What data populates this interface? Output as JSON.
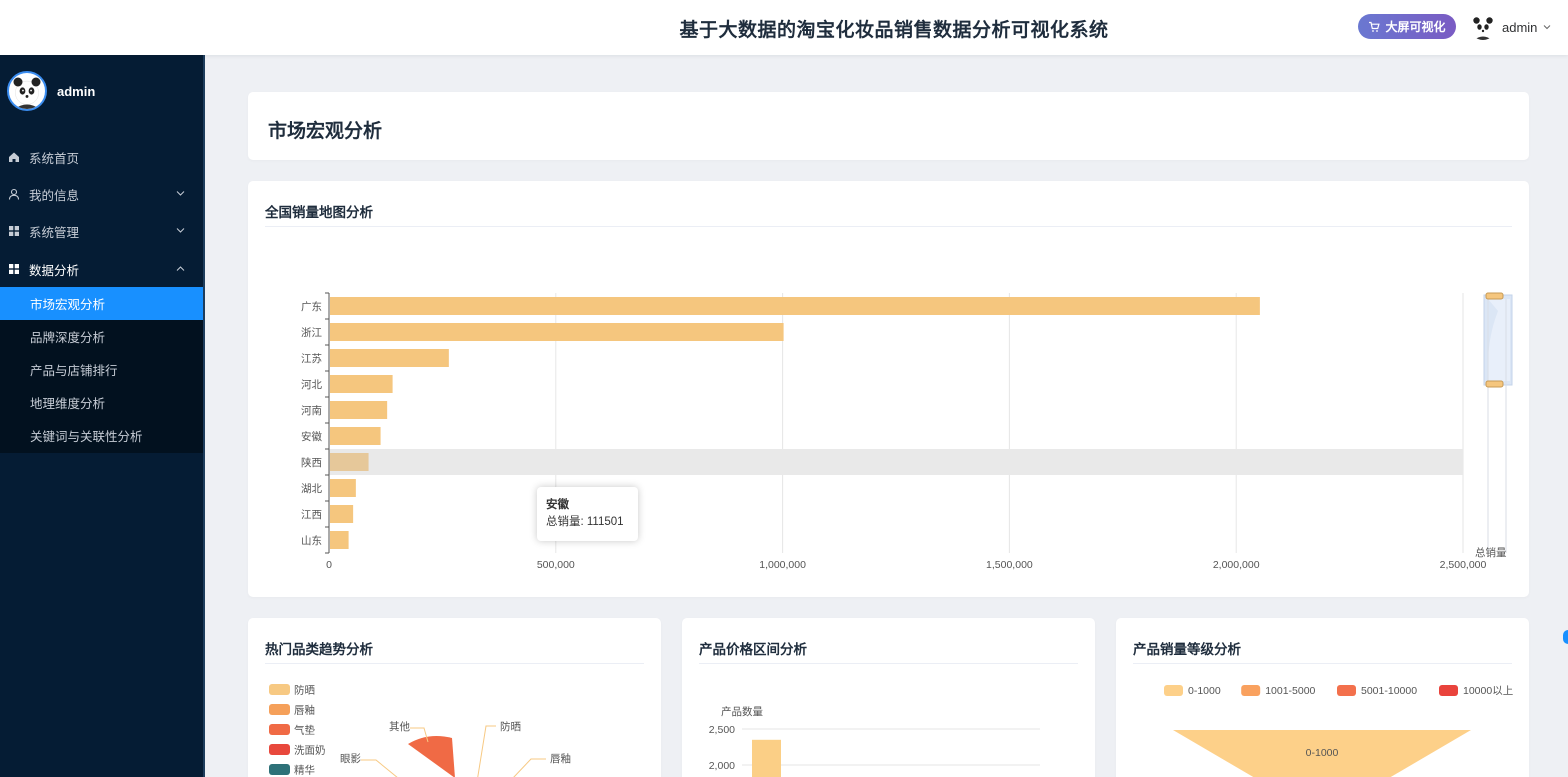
{
  "header": {
    "title": "基于大数据的淘宝化妆品销售数据分析可视化系统",
    "bigscreen_label": "大屏可视化",
    "username": "admin"
  },
  "sidebar": {
    "username": "admin",
    "menu": [
      {
        "label": "系统首页",
        "icon": "home-icon"
      },
      {
        "label": "我的信息",
        "icon": "user-icon"
      },
      {
        "label": "系统管理",
        "icon": "grid-icon"
      },
      {
        "label": "数据分析",
        "icon": "grid-icon"
      }
    ],
    "submenu": [
      {
        "label": "市场宏观分析",
        "active": true
      },
      {
        "label": "品牌深度分析"
      },
      {
        "label": "产品与店铺排行"
      },
      {
        "label": "地理维度分析"
      },
      {
        "label": "关键词与关联性分析"
      }
    ]
  },
  "page": {
    "title": "市场宏观分析"
  },
  "map_card": {
    "title": "全国销量地图分析",
    "tooltip": {
      "name": "安徽",
      "label": "总销量: 111501"
    }
  },
  "bottom_cards": [
    {
      "title": "热门品类趋势分析"
    },
    {
      "title": "产品价格区间分析"
    },
    {
      "title": "产品销量等级分析"
    }
  ],
  "chart_data": [
    {
      "type": "bar",
      "orientation": "horizontal",
      "categories": [
        "广东",
        "浙江",
        "江苏",
        "河北",
        "河南",
        "安徽",
        "陕西",
        "湖北",
        "江西",
        "山东"
      ],
      "values": [
        2050000,
        1000000,
        262000,
        138000,
        126000,
        111501,
        85000,
        57000,
        51000,
        41000
      ],
      "xlim": [
        0,
        2500000
      ],
      "xticks": [
        "0",
        "500,000",
        "1,000,000",
        "1,500,000",
        "2,000,000",
        "2,500,000"
      ],
      "color": "#f5c67e",
      "highlight_category": "陕西",
      "visual_map_label": "总销量",
      "grid": true
    },
    {
      "type": "pie",
      "legend": [
        "防晒",
        "唇釉",
        "气垫",
        "洗面奶",
        "精华"
      ],
      "slice_labels": [
        "其他",
        "防晒",
        "眼影",
        "唇釉"
      ],
      "colors": [
        "#f7c983",
        "#f5a05a",
        "#f06a45",
        "#e8483c",
        "#2e7178"
      ]
    },
    {
      "type": "bar",
      "ylabel": "产品数量",
      "yticks": [
        "2,500",
        "2,000"
      ],
      "color": "#fbcf86",
      "values": [
        2350
      ]
    },
    {
      "type": "funnel",
      "legend": [
        "0-1000",
        "1001-5000",
        "5001-10000",
        "10000以上"
      ],
      "colors": [
        "#fdd089",
        "#f9a15f",
        "#f3704c",
        "#e9433c"
      ],
      "visible_label": "0-1000"
    }
  ]
}
